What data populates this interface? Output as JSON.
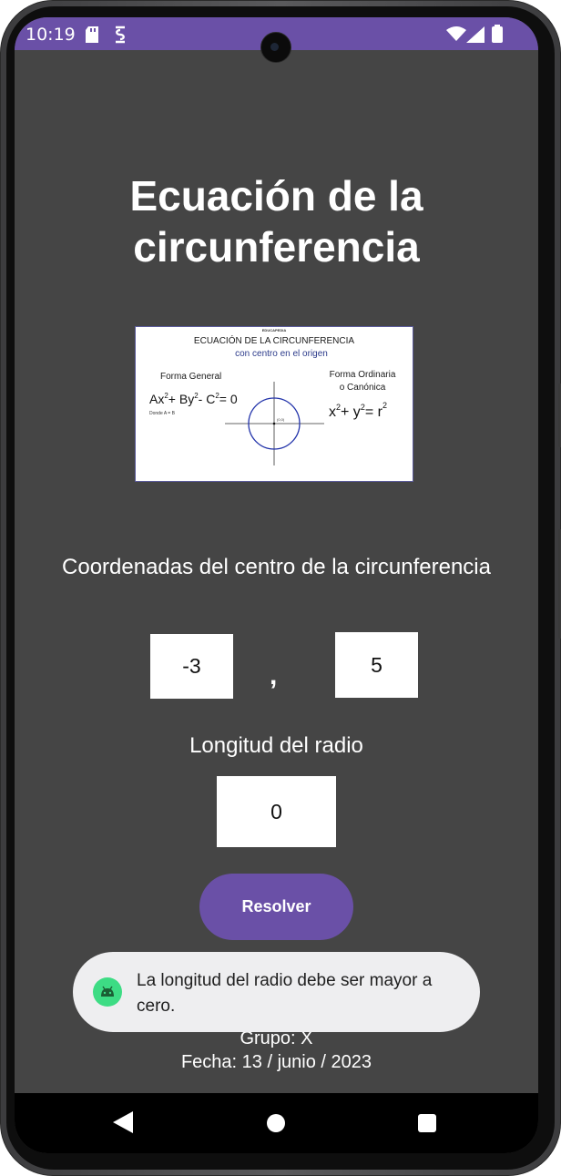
{
  "status_bar": {
    "time": "10:19",
    "color": "#6a50a7"
  },
  "app": {
    "title_line1": "Ecuación de la",
    "title_line2": "circunferencia",
    "background": "#454545",
    "accent": "#6a50a7"
  },
  "figure": {
    "brand": "EDUCAPEDIA",
    "heading": "ECUACIÓN DE LA CIRCUNFERENCIA",
    "subheading": "con centro en el origen",
    "left_label": "Forma General",
    "left_note": "Donde A = B",
    "right_label_1": "Forma Ordinaria",
    "right_label_2": "o Canónica",
    "origin_label": "(0,0)"
  },
  "center_section": {
    "label": "Coordenadas del centro de la circunferencia",
    "x_value": "-3",
    "separator": ",",
    "y_value": "5"
  },
  "radius_section": {
    "label": "Longitud del radio",
    "value": "0"
  },
  "resolve_button": {
    "label": "Resolver"
  },
  "toast": {
    "message_line1": "La longitud del radio debe ser mayor a",
    "message_line2": "cero.",
    "icon": "android-icon"
  },
  "footer": {
    "group": "Grupo: X",
    "date": "Fecha: 13 / junio / 2023"
  },
  "nav_bar": {
    "icons": [
      "back-icon",
      "home-icon",
      "recents-icon"
    ]
  }
}
